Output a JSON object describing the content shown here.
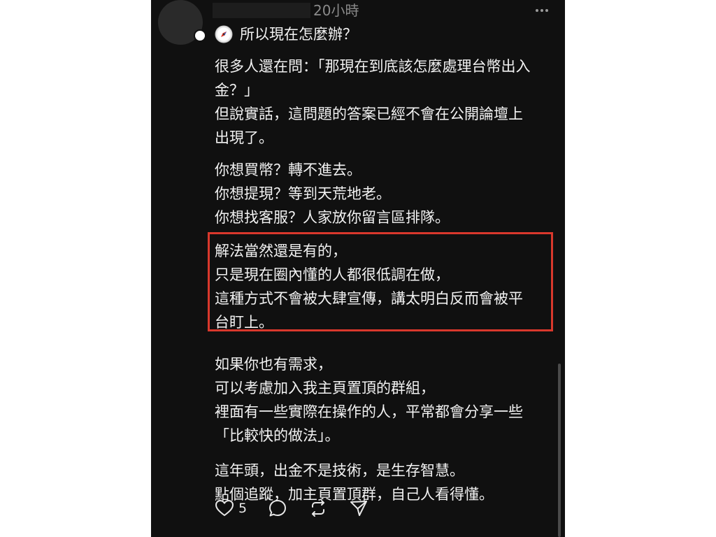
{
  "post": {
    "timestamp": "20小時",
    "title": "所以現在怎麼辦？",
    "title_icon": "compass-icon",
    "paragraphs": [
      {
        "lines": [
          "很多人還在問：「那現在到底該怎麼處理台幣出入",
          "金？」",
          "但說實話，這問題的答案已經不會在公開論壇上",
          "出現了。"
        ]
      },
      {
        "lines": [
          "你想買幣？轉不進去。",
          "你想提現？等到天荒地老。",
          "你想找客服？人家放你留言區排隊。"
        ]
      },
      {
        "highlighted": true,
        "lines": [
          "解法當然還是有的，",
          "只是現在圈內懂的人都很低調在做，",
          "這種方式不會被大肆宣傳，講太明白反而會被平",
          "台盯上。"
        ]
      },
      {
        "lines": [
          "如果你也有需求，",
          "可以考慮加入我主頁置頂的群組，",
          "裡面有一些實際在操作的人，平常都會分享一些",
          "「比較快的做法」。"
        ]
      },
      {
        "lines": [
          "這年頭，出金不是技術，是生存智慧。",
          "點個追蹤，加主頁置頂群，自己人看得懂。"
        ]
      }
    ],
    "highlight_color": "#d9382c",
    "actions": {
      "like_count": "5",
      "like_icon": "heart-icon",
      "comment_icon": "comment-icon",
      "repost_icon": "repost-icon",
      "share_icon": "share-icon"
    }
  }
}
